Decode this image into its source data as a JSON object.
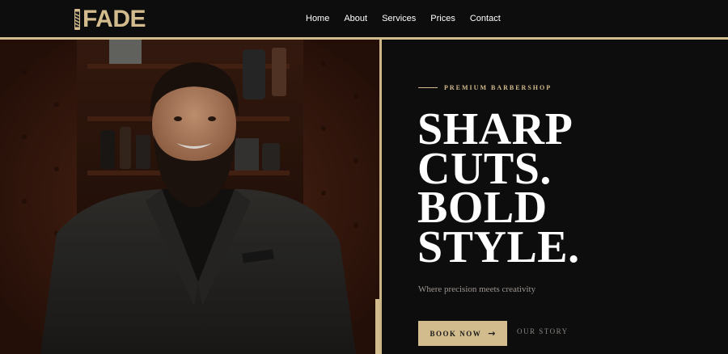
{
  "brand": {
    "name": "FADE"
  },
  "nav": {
    "items": [
      "Home",
      "About",
      "Services",
      "Prices",
      "Contact"
    ]
  },
  "hero": {
    "eyebrow": "PREMIUM BARBERSHOP",
    "headline": [
      "SHARP",
      "CUTS.",
      "BOLD",
      "STYLE."
    ],
    "tagline": "Where precision meets creativity",
    "cta_primary": "BOOK NOW",
    "cta_primary_icon": "→",
    "cta_secondary": "OUR STORY"
  },
  "colors": {
    "accent": "#d2bb8c",
    "background": "#0d0d0d"
  }
}
